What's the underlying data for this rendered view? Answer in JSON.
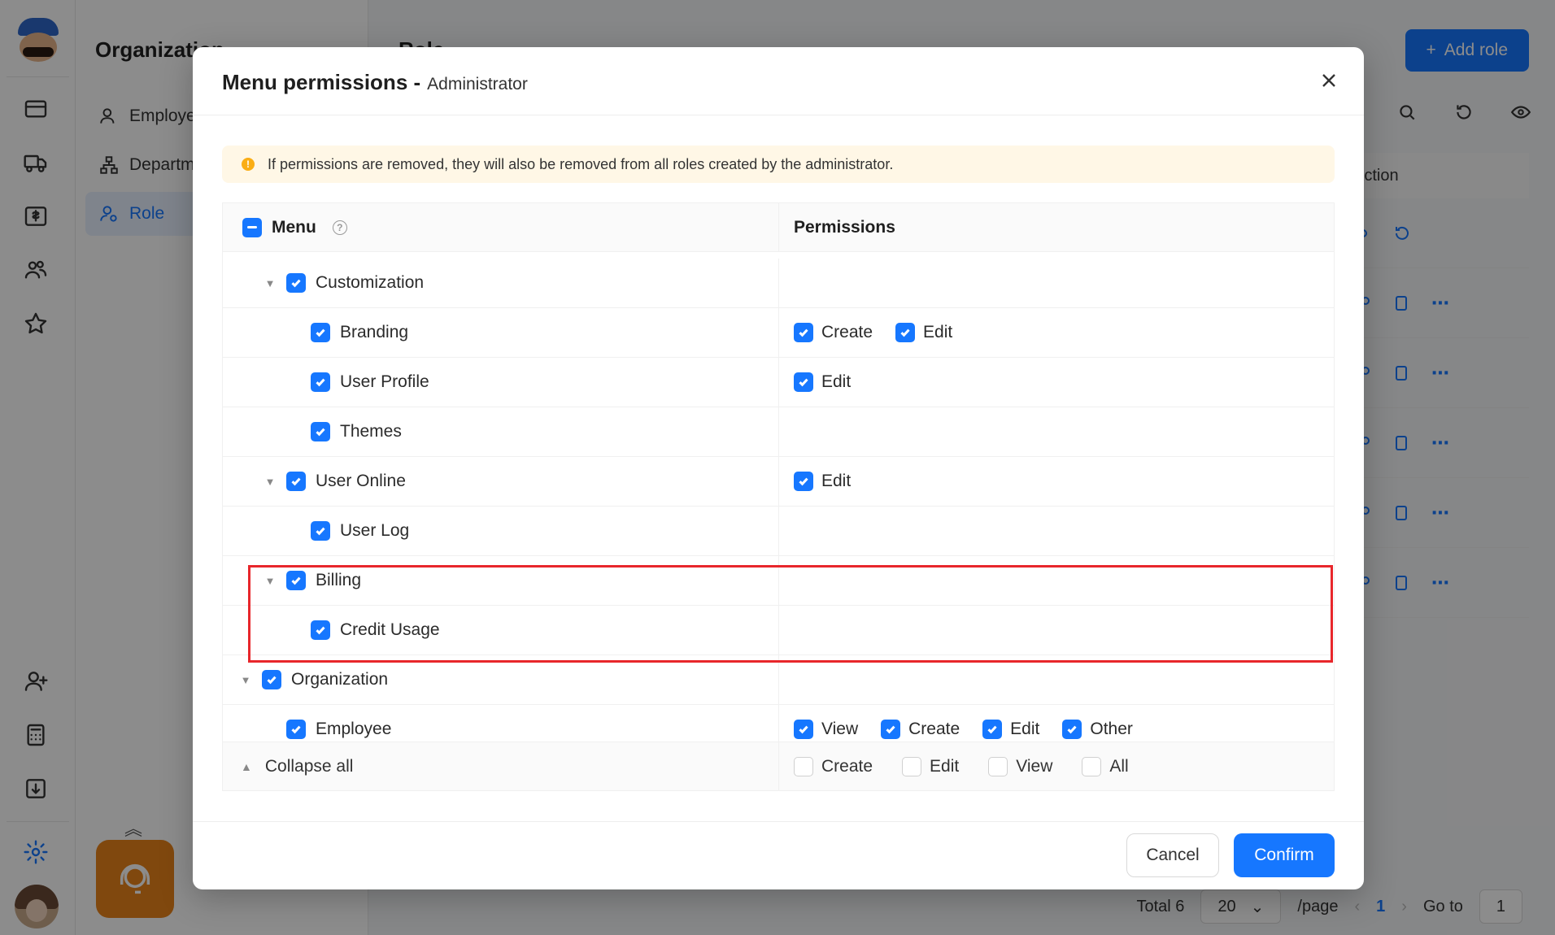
{
  "app": {
    "section_title": "Organization",
    "page_title": "Role",
    "subnav": [
      {
        "label": "Employee",
        "icon": "user-icon"
      },
      {
        "label": "Department",
        "icon": "org-tree-icon"
      },
      {
        "label": "Role",
        "icon": "role-icon",
        "active": true
      }
    ],
    "add_role_label": "Add role",
    "action_header": "Action",
    "pagination": {
      "total_label": "Total 6",
      "page_size": "20",
      "per_page_label": "/page",
      "current_page": "1",
      "goto_label": "Go to",
      "goto_value": "1"
    }
  },
  "modal": {
    "title": "Menu permissions -",
    "subtitle": "Administrator",
    "alert": "If permissions are removed, they will also be removed from all roles created by the administrator.",
    "col_menu": "Menu",
    "col_permissions": "Permissions",
    "rows": [
      {
        "label": "Customization",
        "level": 1,
        "expandable": true,
        "perms": []
      },
      {
        "label": "Branding",
        "level": 2,
        "expandable": false,
        "perms": [
          "Create",
          "Edit"
        ]
      },
      {
        "label": "User Profile",
        "level": 2,
        "expandable": false,
        "perms": [
          "Edit"
        ]
      },
      {
        "label": "Themes",
        "level": 2,
        "expandable": false,
        "perms": []
      },
      {
        "label": "User Online",
        "level": 1,
        "expandable": true,
        "perms": [
          "Edit"
        ]
      },
      {
        "label": "User Log",
        "level": 2,
        "expandable": false,
        "perms": []
      },
      {
        "label": "Billing",
        "level": 1,
        "expandable": true,
        "perms": []
      },
      {
        "label": "Credit Usage",
        "level": 2,
        "expandable": false,
        "perms": []
      },
      {
        "label": "Organization",
        "level": 0,
        "expandable": true,
        "perms": []
      },
      {
        "label": "Employee",
        "level": 1,
        "expandable": false,
        "perms": [
          "View",
          "Create",
          "Edit",
          "Other"
        ]
      }
    ],
    "footer": {
      "collapse_label": "Collapse all",
      "bulk_perms": [
        "Create",
        "Edit",
        "View",
        "All"
      ]
    },
    "cancel_label": "Cancel",
    "confirm_label": "Confirm"
  },
  "colors": {
    "accent": "#1677ff",
    "highlight": "#e8262b",
    "alert_bg": "#fff7e6",
    "warn": "#faad14"
  }
}
